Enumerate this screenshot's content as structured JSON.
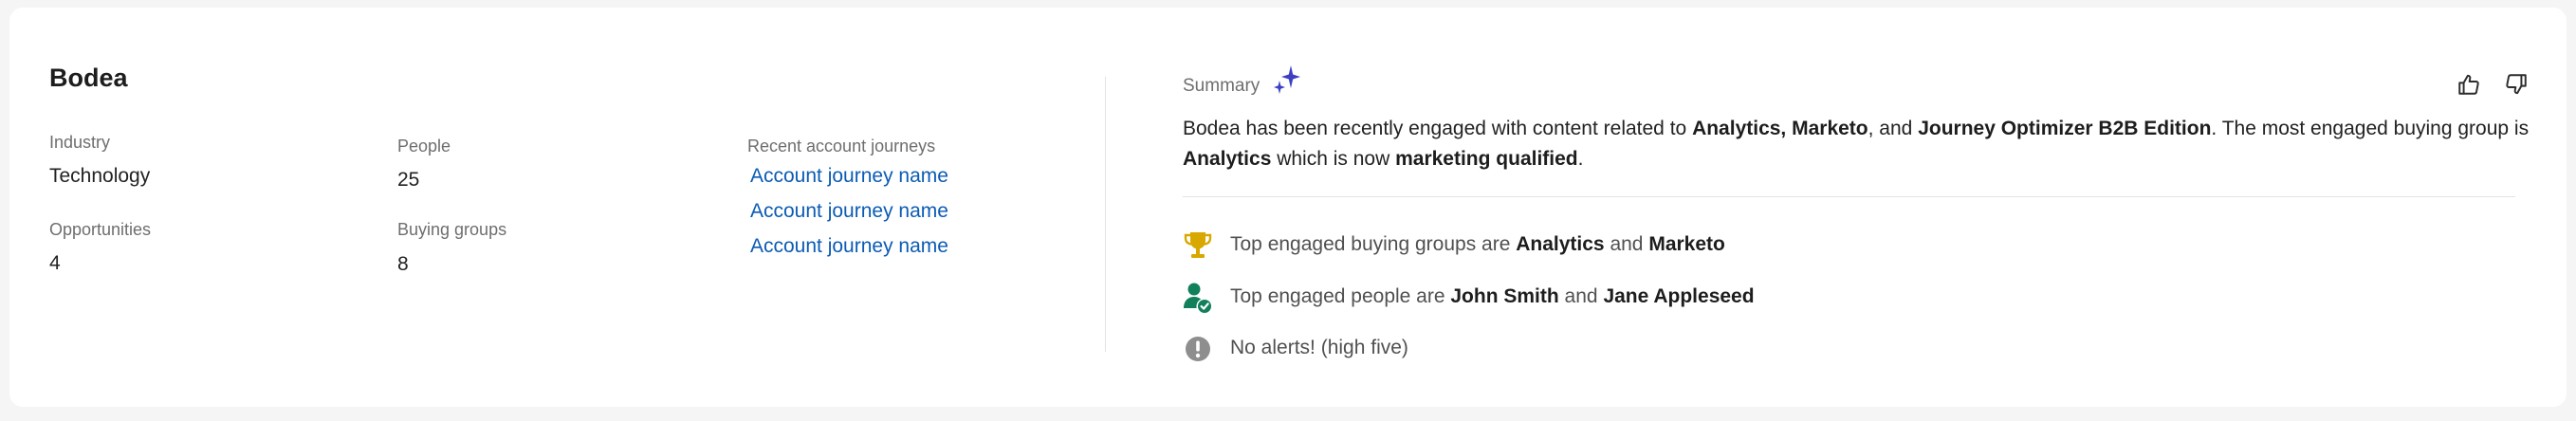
{
  "account": {
    "name": "Bodea",
    "industry_label": "Industry",
    "industry_value": "Technology",
    "opportunities_label": "Opportunities",
    "opportunities_value": "4",
    "people_label": "People",
    "people_value": "25",
    "buying_groups_label": "Buying groups",
    "buying_groups_value": "8",
    "journeys_label": "Recent account journeys",
    "journeys": [
      "Account journey name",
      "Account journey name",
      "Account journey name"
    ]
  },
  "summary": {
    "label": "Summary",
    "sparkle_icon": "ai-sparkle-icon",
    "sparkle_color": "#3d3fc4",
    "feedback": {
      "thumbs_up_icon": "thumbs-up-icon",
      "thumbs_down_icon": "thumbs-down-icon"
    },
    "text": {
      "p1": "Bodea has been recently engaged with content related to ",
      "b1": "Analytics, Marketo",
      "p2": ", and ",
      "b2": "Journey Optimizer B2B Edition",
      "p3": ". The most engaged buying group is ",
      "b3": "Analytics",
      "p4": " which is now ",
      "b4": "marketing qualified",
      "p5": "."
    },
    "insights": [
      {
        "icon": "trophy-icon",
        "color": "#d9a800",
        "t1": "Top engaged buying groups are ",
        "b1": "Analytics",
        "t2": " and ",
        "b2": "Marketo"
      },
      {
        "icon": "user-engaged-icon",
        "color": "#12805c",
        "t1": "Top engaged people are ",
        "b1": "John Smith",
        "t2": " and ",
        "b2": "Jane Appleseed"
      },
      {
        "icon": "alert-icon",
        "color": "#8e8e8e",
        "t1": "No alerts! (high five)"
      }
    ]
  }
}
